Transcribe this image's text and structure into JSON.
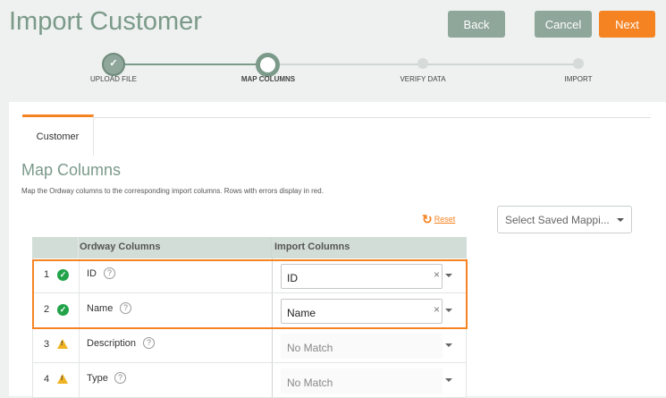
{
  "header": {
    "title": "Import Customer",
    "back_label": "Back",
    "cancel_label": "Cancel",
    "next_label": "Next"
  },
  "stepper": {
    "steps": [
      {
        "label": "UPLOAD FILE",
        "state": "done",
        "icon": "check-icon"
      },
      {
        "label": "MAP COLUMNS",
        "state": "current"
      },
      {
        "label": "VERIFY DATA",
        "state": "todo"
      },
      {
        "label": "IMPORT",
        "state": "todo"
      }
    ]
  },
  "tabs": [
    {
      "label": "Customer",
      "active": true
    }
  ],
  "section": {
    "title": "Map Columns",
    "description": "Map the Ordway columns to the corresponding import columns. Rows with errors display in red.",
    "reset_label": "Reset",
    "saved_mapping_placeholder": "Select Saved Mappi..."
  },
  "table": {
    "columns": [
      "Ordway Columns",
      "Import Columns"
    ],
    "rows": [
      {
        "num": "1",
        "status": "ok",
        "field": "ID",
        "value": "ID"
      },
      {
        "num": "2",
        "status": "ok",
        "field": "Name",
        "value": "Name"
      },
      {
        "num": "3",
        "status": "warning",
        "field": "Description",
        "value": "No Match"
      },
      {
        "num": "4",
        "status": "warning",
        "field": "Type",
        "value": "No Match"
      }
    ]
  },
  "colors": {
    "accent": "#f68322",
    "brand_green": "#7b9a8a",
    "button_gray": "#8fa69a",
    "ok": "#22a34a",
    "warning": "#f0b323"
  }
}
